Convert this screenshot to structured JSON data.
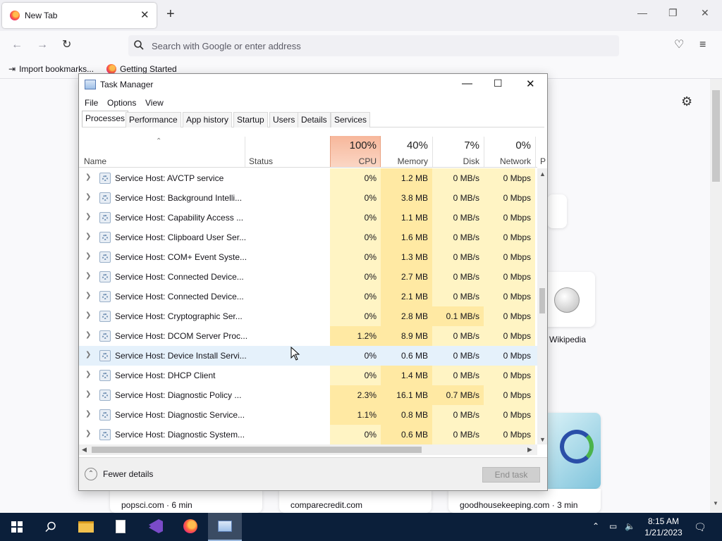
{
  "browser": {
    "tab_title": "New Tab",
    "search_placeholder": "Search with Google or enter address",
    "bookmarks": [
      "Import bookmarks...",
      "Getting Started"
    ],
    "shortcut_caption": "Wikipedia",
    "stories": [
      "popsci.com · 6 min",
      "comparecredit.com",
      "goodhousekeeping.com · 3 min"
    ]
  },
  "taskmanager": {
    "title": "Task Manager",
    "menu": [
      "File",
      "Options",
      "View"
    ],
    "tabs": [
      "Processes",
      "Performance",
      "App history",
      "Startup",
      "Users",
      "Details",
      "Services"
    ],
    "columns": {
      "name": "Name",
      "status": "Status",
      "cpu": {
        "pct": "100%",
        "label": "CPU"
      },
      "memory": {
        "pct": "40%",
        "label": "Memory"
      },
      "disk": {
        "pct": "7%",
        "label": "Disk"
      },
      "network": {
        "pct": "0%",
        "label": "Network"
      },
      "power": "P"
    },
    "rows": [
      {
        "name": "Service Host: AVCTP service",
        "cpu": "0%",
        "mem": "1.2 MB",
        "disk": "0 MB/s",
        "net": "0 Mbps"
      },
      {
        "name": "Service Host: Background Intelli...",
        "cpu": "0%",
        "mem": "3.8 MB",
        "disk": "0 MB/s",
        "net": "0 Mbps"
      },
      {
        "name": "Service Host: Capability Access ...",
        "cpu": "0%",
        "mem": "1.1 MB",
        "disk": "0 MB/s",
        "net": "0 Mbps"
      },
      {
        "name": "Service Host: Clipboard User Ser...",
        "cpu": "0%",
        "mem": "1.6 MB",
        "disk": "0 MB/s",
        "net": "0 Mbps"
      },
      {
        "name": "Service Host: COM+ Event Syste...",
        "cpu": "0%",
        "mem": "1.3 MB",
        "disk": "0 MB/s",
        "net": "0 Mbps"
      },
      {
        "name": "Service Host: Connected Device...",
        "cpu": "0%",
        "mem": "2.7 MB",
        "disk": "0 MB/s",
        "net": "0 Mbps"
      },
      {
        "name": "Service Host: Connected Device...",
        "cpu": "0%",
        "mem": "2.1 MB",
        "disk": "0 MB/s",
        "net": "0 Mbps"
      },
      {
        "name": "Service Host: Cryptographic Ser...",
        "cpu": "0%",
        "mem": "2.8 MB",
        "disk": "0.1 MB/s",
        "net": "0 Mbps"
      },
      {
        "name": "Service Host: DCOM Server Proc...",
        "cpu": "1.2%",
        "mem": "8.9 MB",
        "disk": "0 MB/s",
        "net": "0 Mbps"
      },
      {
        "name": "Service Host: Device Install Servi...",
        "cpu": "0%",
        "mem": "0.6 MB",
        "disk": "0 MB/s",
        "net": "0 Mbps"
      },
      {
        "name": "Service Host: DHCP Client",
        "cpu": "0%",
        "mem": "1.4 MB",
        "disk": "0 MB/s",
        "net": "0 Mbps"
      },
      {
        "name": "Service Host: Diagnostic Policy ...",
        "cpu": "2.3%",
        "mem": "16.1 MB",
        "disk": "0.7 MB/s",
        "net": "0 Mbps"
      },
      {
        "name": "Service Host: Diagnostic Service...",
        "cpu": "1.1%",
        "mem": "0.8 MB",
        "disk": "0 MB/s",
        "net": "0 Mbps"
      },
      {
        "name": "Service Host: Diagnostic System...",
        "cpu": "0%",
        "mem": "0.6 MB",
        "disk": "0 MB/s",
        "net": "0 Mbps"
      }
    ],
    "hover_row": 9,
    "fewer_details": "Fewer details",
    "end_task": "End task"
  },
  "taskbar": {
    "time": "8:15 AM",
    "date": "1/21/2023"
  },
  "colors": {
    "cpu_header": "#f7b79b",
    "cell_light": "#fff4c4",
    "cell_mid": "#ffe9a3",
    "cell_hover": "#e5f1fb",
    "taskbar": "#0b1f3a"
  }
}
